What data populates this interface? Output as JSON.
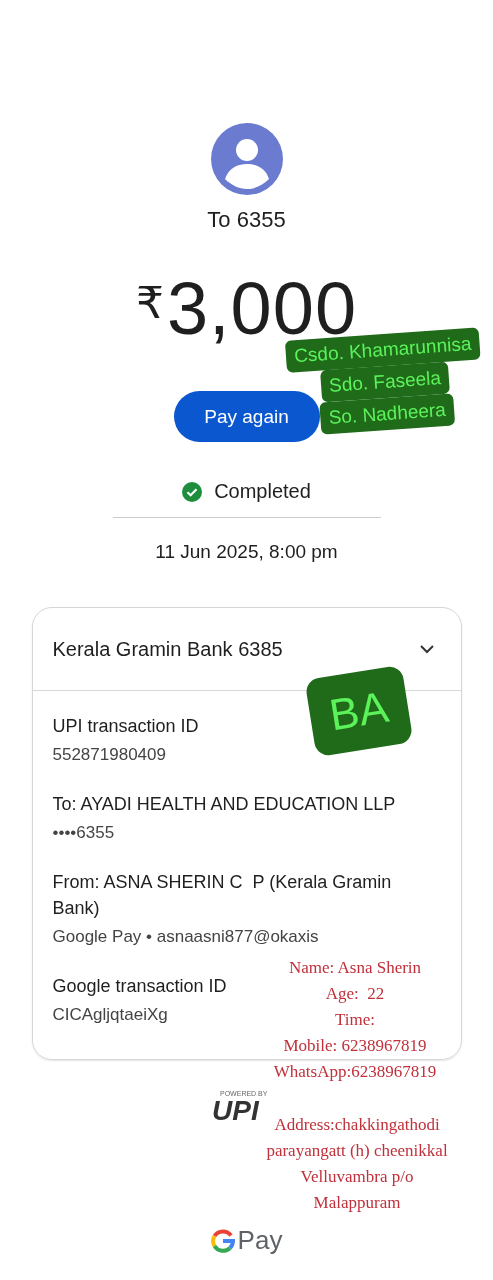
{
  "recipient": {
    "label": "To 6355"
  },
  "amount": {
    "currency": "₹",
    "value": "3,000"
  },
  "actions": [
    {
      "label": "Pay again"
    }
  ],
  "status": {
    "kind": "completed",
    "text": "Completed"
  },
  "timestamp": "11 Jun 2025, 8:00 pm",
  "details_card": {
    "title": "Kerala Gramin Bank 6385",
    "fields": [
      {
        "label": "UPI transaction ID",
        "value": "552871980409"
      },
      {
        "label": "To: AYADI HEALTH AND EDUCATION LLP",
        "value": "••••6355"
      },
      {
        "label": "From: ASNA SHERIN C  P (Kerala Gramin Bank)",
        "value": "Google Pay • asnaasni877@okaxis"
      },
      {
        "label": "Google transaction ID",
        "value": "CICAgljqtaeiXg"
      }
    ]
  },
  "upi_logo": {
    "caption": "POWERED BY",
    "mark": "UPI"
  },
  "footer": {
    "brand": "Pay"
  },
  "annotations": {
    "stickers": [
      {
        "lines": [
          "Csdo. Khamarunnisa",
          "Sdo. Faseela",
          "So. Nadheera"
        ]
      },
      {
        "lines": [
          "BA"
        ]
      }
    ],
    "notes": [
      {
        "lines": [
          "Name: Asna Sherin",
          "Age:  22",
          "Time:",
          "Mobile: 6238967819",
          "WhatsApp:6238967819"
        ]
      },
      {
        "lines": [
          "Address:chakkingathodi",
          "parayangatt (h) cheenikkal",
          "Velluvambra p/o",
          "Malappuram"
        ]
      }
    ]
  }
}
